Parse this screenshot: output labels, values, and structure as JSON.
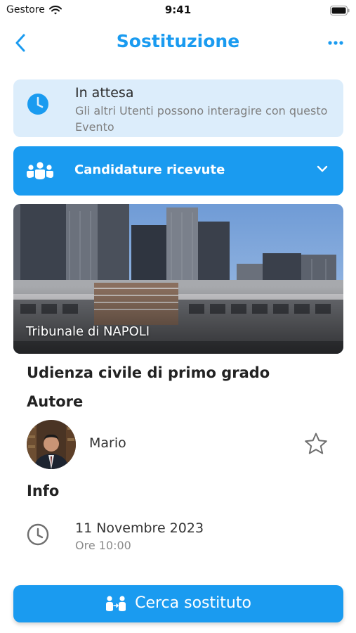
{
  "statusbar": {
    "carrier": "Gestore",
    "time": "9:41"
  },
  "nav": {
    "title": "Sostituzione"
  },
  "status_card": {
    "title": "In attesa",
    "description": "Gli altri Utenti possono interagire con questo Evento"
  },
  "candidature": {
    "label": "Candidature ricevute"
  },
  "hero": {
    "caption": "Tribunale di NAPOLI"
  },
  "event": {
    "title": "Udienza civile di primo grado"
  },
  "author": {
    "heading": "Autore",
    "name": "Mario"
  },
  "info": {
    "heading": "Info",
    "date": "11 Novembre 2023",
    "time": "Ore 10:00"
  },
  "cta": {
    "label": "Cerca sostituto"
  },
  "colors": {
    "accent": "#1a9bf0",
    "status_bg": "#dcedfb"
  }
}
